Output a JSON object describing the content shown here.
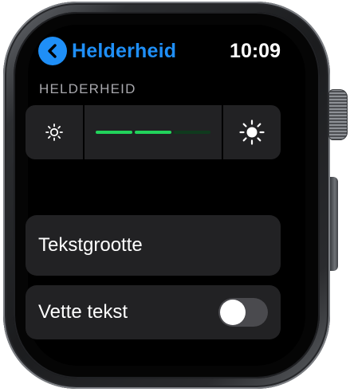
{
  "header": {
    "back_label": "Helderheid",
    "time": "10:09"
  },
  "brightness": {
    "section_label": "HELDERHEID",
    "level_segments_on": 2,
    "level_segments_total": 3,
    "decrease_icon": "sun-small-icon",
    "increase_icon": "sun-large-icon",
    "accent_color": "#22d35b"
  },
  "rows": {
    "text_size_label": "Tekstgrootte",
    "bold_text_label": "Vette tekst",
    "bold_text_enabled": false
  },
  "colors": {
    "accent_blue": "#1f8ff7",
    "background": "#000000",
    "row_background": "#222224"
  }
}
